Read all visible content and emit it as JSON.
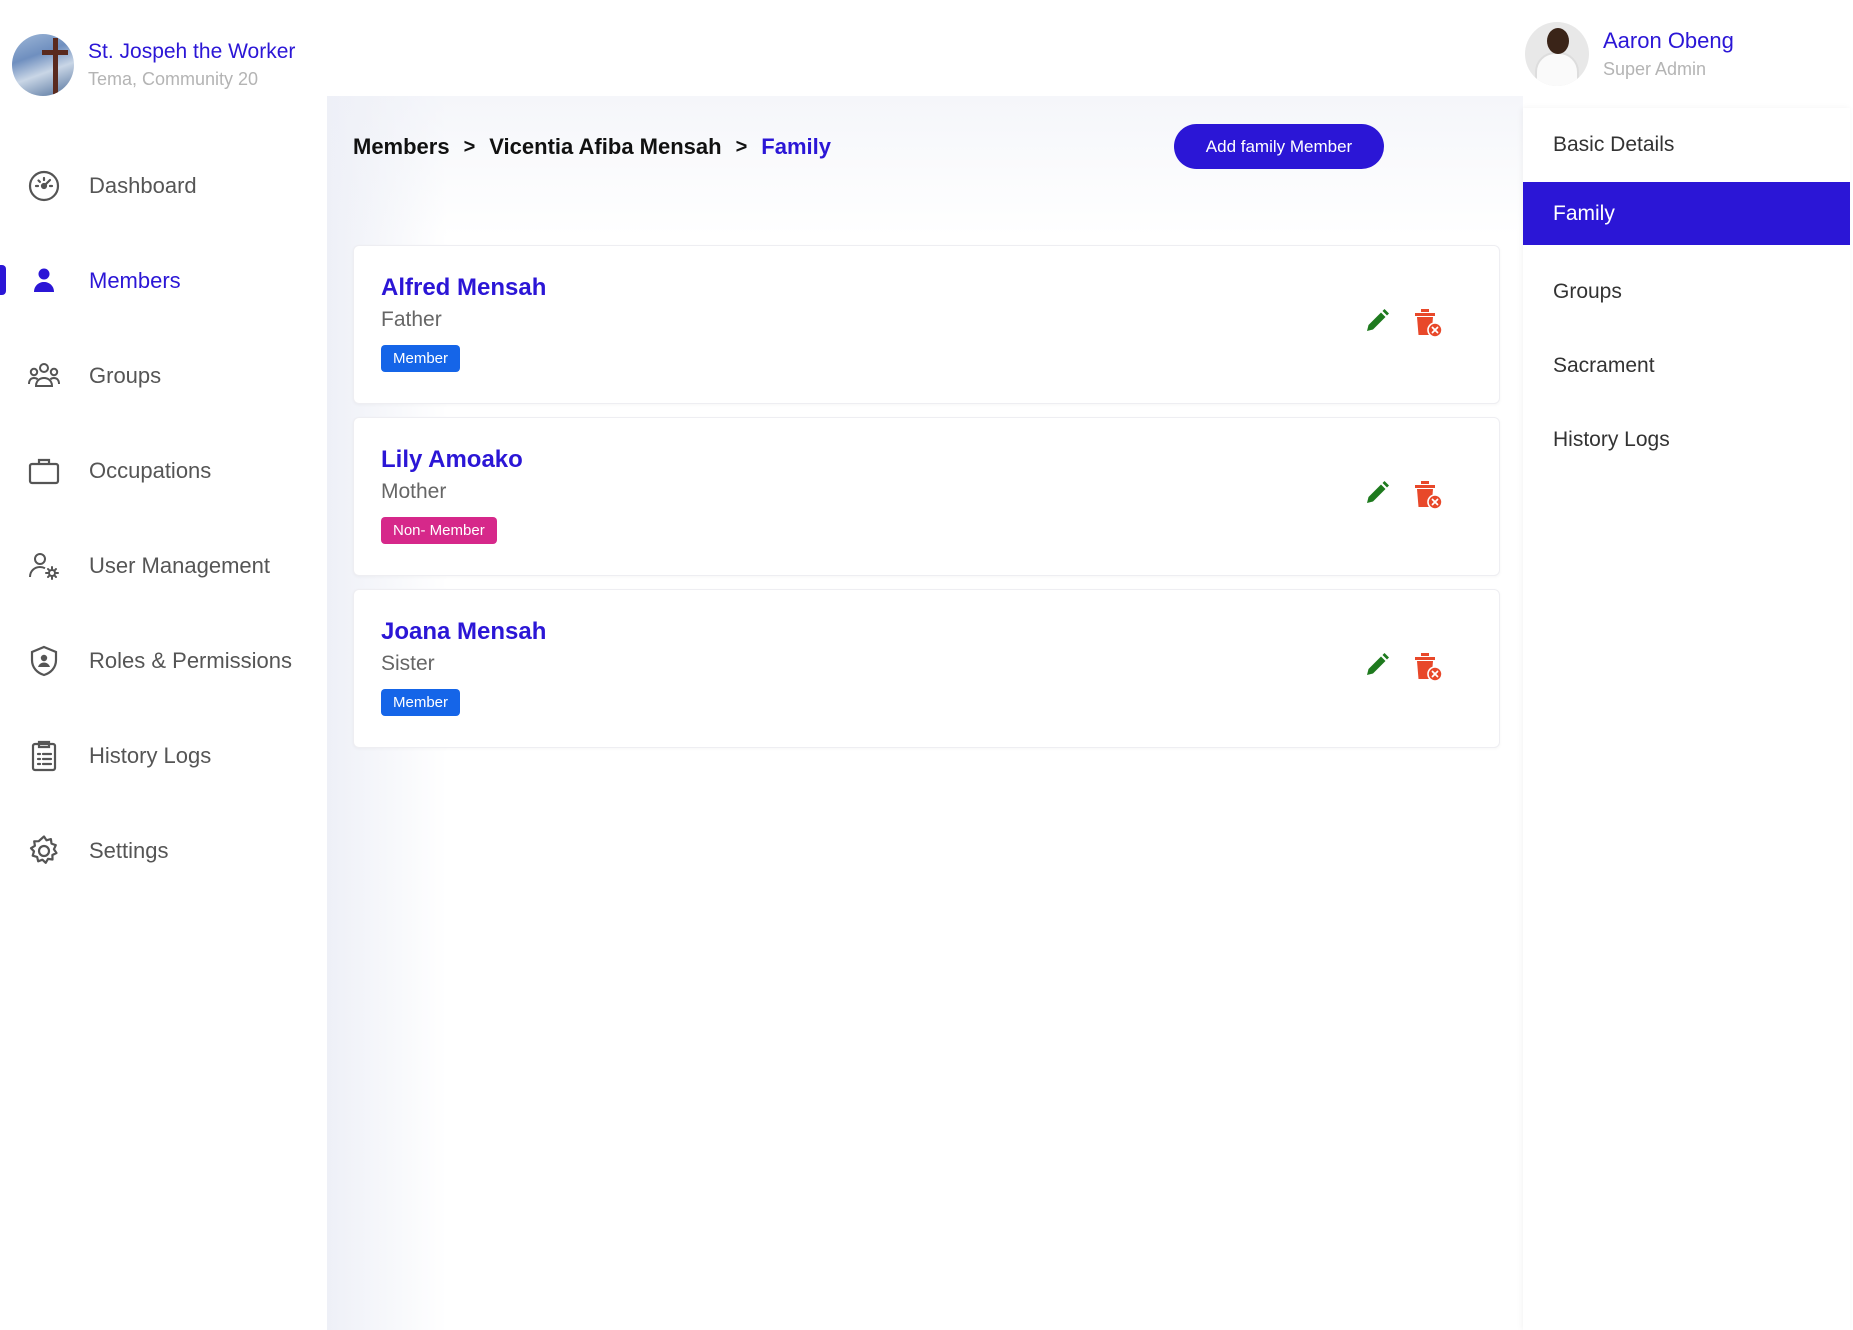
{
  "brand": {
    "name": "St. Jospeh the Worker",
    "location": "Tema, Community 20"
  },
  "user": {
    "name": "Aaron Obeng",
    "role": "Super Admin"
  },
  "nav": {
    "items": [
      {
        "label": "Dashboard",
        "icon": "gauge-icon",
        "active": false
      },
      {
        "label": "Members",
        "icon": "person-icon",
        "active": true
      },
      {
        "label": "Groups",
        "icon": "group-icon",
        "active": false
      },
      {
        "label": "Occupations",
        "icon": "briefcase-icon",
        "active": false
      },
      {
        "label": "User Management",
        "icon": "user-gear-icon",
        "active": false
      },
      {
        "label": "Roles & Permissions",
        "icon": "shield-user-icon",
        "active": false
      },
      {
        "label": "History Logs",
        "icon": "clipboard-list-icon",
        "active": false
      },
      {
        "label": "Settings",
        "icon": "gear-icon",
        "active": false
      }
    ]
  },
  "breadcrumb": {
    "items": [
      "Members",
      "Vicentia Afiba Mensah"
    ],
    "current": "Family",
    "separator": ">"
  },
  "actions": {
    "add_label": "Add family Member"
  },
  "family": [
    {
      "name": "Alfred Mensah",
      "relation": "Father",
      "status": "Member",
      "status_color": "#1565e8"
    },
    {
      "name": "Lily Amoako",
      "relation": "Mother",
      "status": "Non- Member",
      "status_color": "#d6288a"
    },
    {
      "name": "Joana Mensah",
      "relation": "Sister",
      "status": "Member",
      "status_color": "#1565e8"
    }
  ],
  "tabs": [
    {
      "label": "Basic Details",
      "active": false
    },
    {
      "label": "Family",
      "active": true
    },
    {
      "label": "Groups",
      "active": false
    },
    {
      "label": "Sacrament",
      "active": false
    },
    {
      "label": "History Logs",
      "active": false
    }
  ],
  "colors": {
    "accent": "#2b16d6",
    "edit": "#1e7a1e",
    "delete": "#e8482a"
  }
}
